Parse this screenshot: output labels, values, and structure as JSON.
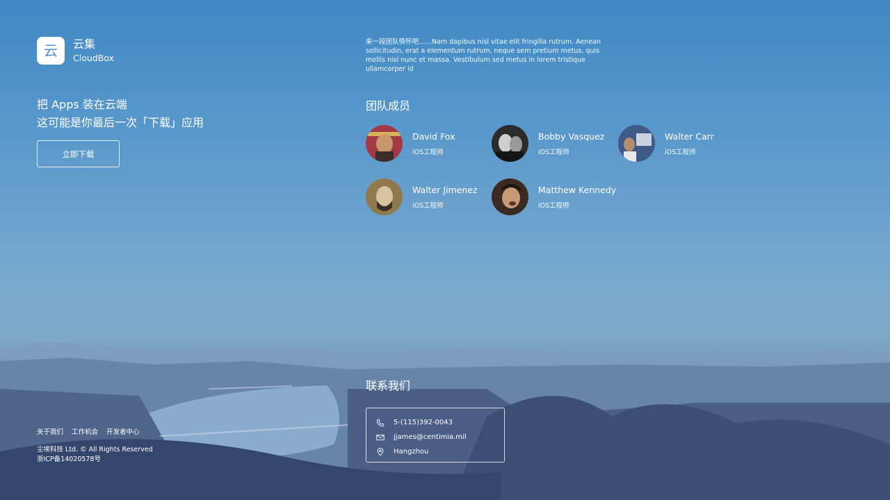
{
  "brand": {
    "name": "云集",
    "subtitle": "CloudBox",
    "icon": "cloud-char-icon",
    "icon_char": "云",
    "icon_color": "#4a8fcb"
  },
  "hero": {
    "line1": "把 Apps 装在云端",
    "line2": "这可能是你最后一次「下载」应用",
    "button": "立即下载"
  },
  "intro": "来一段团队情怀吧……Nam dapibus nisl vitae elit fringilla rutrum. Aenean sollicitudin, erat a elementum rutrum, neque sem pretium metus, quis mollis nisl nunc et massa. Vestibulum sed metus in lorem tristique ullamcorper id",
  "team": {
    "heading": "团队成员",
    "members": [
      {
        "name": "David Fox",
        "role": "iOS工程师"
      },
      {
        "name": "Bobby Vasquez",
        "role": "iOS工程师"
      },
      {
        "name": "Walter Carr",
        "role": "iOS工程师"
      },
      {
        "name": "Walter Jimenez",
        "role": "iOS工程师"
      },
      {
        "name": "Matthew Kennedy",
        "role": "iOS工程师"
      }
    ]
  },
  "contact": {
    "heading": "联系我们",
    "phone": "5-(115)392-0043",
    "email": "jjames@centimia.mil",
    "location": "Hangzhou",
    "icons": [
      "phone-icon",
      "mail-icon",
      "location-pin-icon"
    ]
  },
  "footer": {
    "links": [
      "关于我们",
      "工作机会",
      "开发者中心"
    ],
    "copyright": "尘埃科技 Ltd. © All Rights Reserved",
    "icp": "浙ICP备14020578号"
  }
}
